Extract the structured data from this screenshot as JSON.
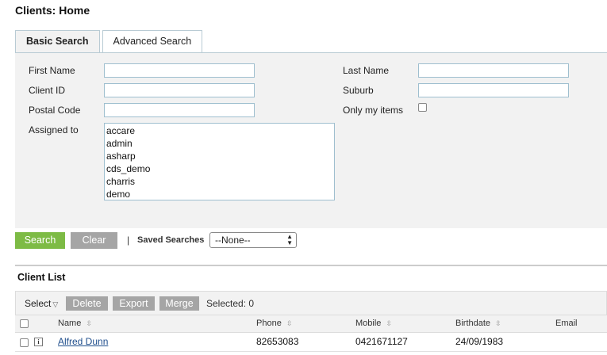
{
  "page": {
    "title": "Clients: Home"
  },
  "tabs": [
    {
      "label": "Basic Search",
      "active": true
    },
    {
      "label": "Advanced Search",
      "active": false
    }
  ],
  "search_form": {
    "first_name": {
      "label": "First Name",
      "value": ""
    },
    "last_name": {
      "label": "Last Name",
      "value": ""
    },
    "client_id": {
      "label": "Client ID",
      "value": ""
    },
    "suburb": {
      "label": "Suburb",
      "value": ""
    },
    "postal_code": {
      "label": "Postal Code",
      "value": ""
    },
    "only_my_items": {
      "label": "Only my items",
      "checked": false
    },
    "assigned_to": {
      "label": "Assigned to",
      "options": [
        "accare",
        "admin",
        "asharp",
        "cds_demo",
        "charris",
        "demo"
      ]
    }
  },
  "actions": {
    "search_label": "Search",
    "clear_label": "Clear",
    "separator": "|",
    "saved_searches_label": "Saved Searches",
    "saved_searches_value": "--None--"
  },
  "client_list": {
    "title": "Client List",
    "toolbar": {
      "select_label": "Select",
      "delete_label": "Delete",
      "export_label": "Export",
      "merge_label": "Merge",
      "selected_text": "Selected: 0"
    },
    "columns": [
      "Name",
      "Phone",
      "Mobile",
      "Birthdate",
      "Email"
    ],
    "rows": [
      {
        "name": "Alfred Dunn",
        "phone": "82653083",
        "mobile": "0421671127",
        "birthdate": "24/09/1983",
        "email": ""
      }
    ]
  },
  "colors": {
    "accent_green": "#7dbb45",
    "button_gray": "#a5a5a5",
    "panel_bg": "#f2f2f2",
    "input_border": "#9fbfcf",
    "link": "#1f4e8c"
  }
}
